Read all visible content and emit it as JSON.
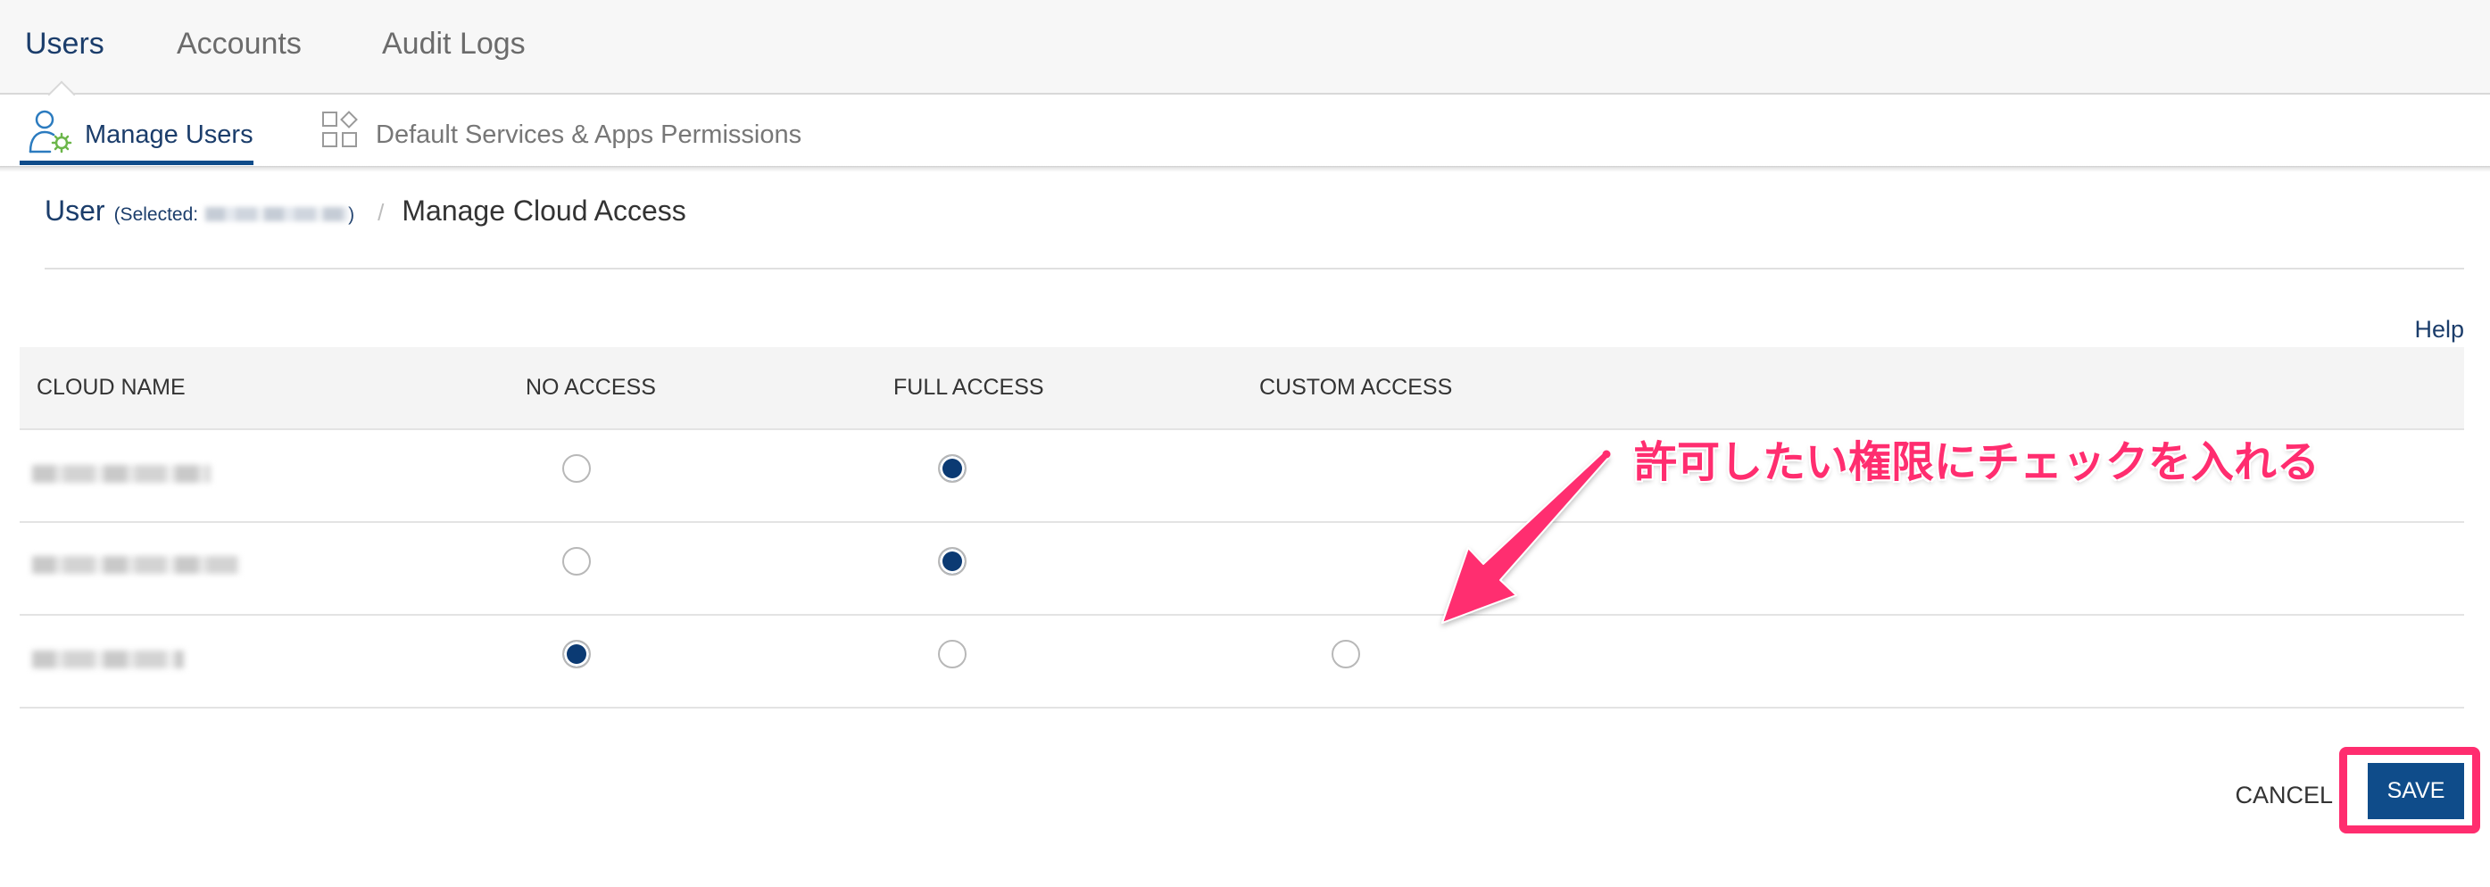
{
  "tabs": [
    {
      "label": "Users",
      "active": true
    },
    {
      "label": "Accounts",
      "active": false
    },
    {
      "label": "Audit Logs",
      "active": false
    }
  ],
  "subtabs": [
    {
      "label": "Manage Users",
      "icon": "user-gear-icon",
      "active": true
    },
    {
      "label": "Default Services & Apps Permissions",
      "icon": "grid-icon",
      "active": false
    }
  ],
  "breadcrumb": {
    "root": "User",
    "selected_prefix": "(Selected:",
    "selected_suffix": ")",
    "separator": "/",
    "current": "Manage Cloud Access"
  },
  "help_label": "Help",
  "table": {
    "columns": [
      "CLOUD NAME",
      "NO ACCESS",
      "FULL ACCESS",
      "CUSTOM ACCESS"
    ],
    "rows": [
      {
        "name_redacted": true,
        "no_access": false,
        "full_access": true,
        "custom_access": null
      },
      {
        "name_redacted": true,
        "no_access": false,
        "full_access": true,
        "custom_access": null
      },
      {
        "name_redacted": true,
        "no_access": true,
        "full_access": false,
        "custom_access": false
      }
    ]
  },
  "annotation": {
    "text": "許可したい権限にチェックを入れる"
  },
  "actions": {
    "cancel_label": "CANCEL",
    "save_label": "SAVE"
  },
  "colors": {
    "accent": "#0f4c8a",
    "navy": "#1b3d6b",
    "annotation": "#ff2d6f"
  }
}
